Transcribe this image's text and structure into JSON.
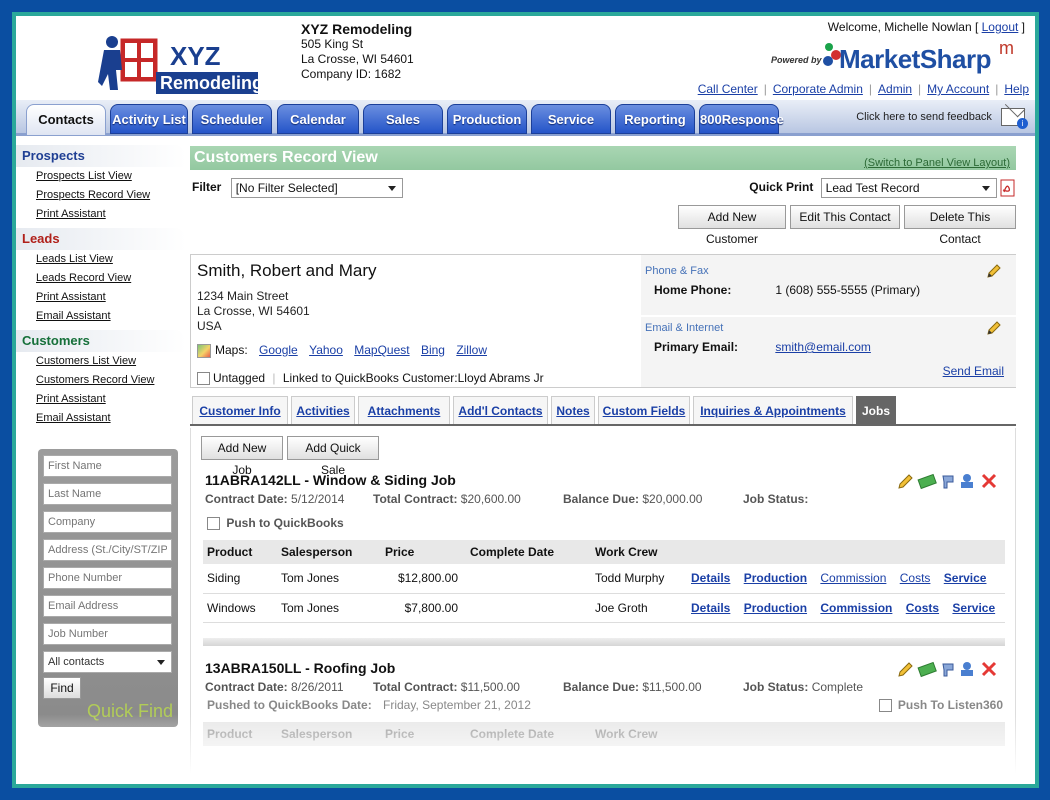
{
  "company": {
    "name": "XYZ Remodeling",
    "address1": "505 King St",
    "address2": "La Crosse, WI 54601",
    "company_id": "Company ID: 1682",
    "logo_line1": "XYZ",
    "logo_line2": "Remodeling"
  },
  "welcome": {
    "text": "Welcome, Michelle Nowlan [ ",
    "logout": "Logout",
    "close": " ]"
  },
  "powered": {
    "label": "Powered by",
    "brand": "MarketSharp",
    "sup": "m"
  },
  "top_links": [
    "Call Center",
    "Corporate Admin",
    "Admin",
    "My Account",
    "Help"
  ],
  "main_tabs": [
    "Contacts",
    "Activity List",
    "Scheduler",
    "Calendar",
    "Sales",
    "Production",
    "Service",
    "Reporting",
    "800Response"
  ],
  "feedback": "Click here to send feedback",
  "sidebar": {
    "prospects": {
      "title": "Prospects",
      "items": [
        "Prospects List View",
        "Prospects Record View",
        "Print Assistant"
      ]
    },
    "leads": {
      "title": "Leads",
      "items": [
        "Leads List View",
        "Leads Record View",
        "Print Assistant",
        "Email Assistant"
      ]
    },
    "customers": {
      "title": "Customers",
      "items": [
        "Customers List View",
        "Customers Record View",
        "Print Assistant",
        "Email Assistant"
      ]
    }
  },
  "quick_find": {
    "placeholders": [
      "First Name",
      "Last Name",
      "Company",
      "Address (St./City/ST/ZIP)",
      "Phone Number",
      "Email Address",
      "Job Number"
    ],
    "select": "All contacts",
    "button": "Find",
    "title": "Quick Find"
  },
  "record": {
    "title": "Customers Record View",
    "switch_link": "(Switch to Panel View Layout)",
    "filter_label": "Filter",
    "filter_value": "[No Filter Selected]",
    "quick_print_label": "Quick Print",
    "quick_print_value": "Lead Test Record",
    "buttons": [
      "Add New Customer",
      "Edit This Contact",
      "Delete This Contact"
    ]
  },
  "contact": {
    "name": "Smith, Robert and Mary",
    "street": "1234 Main Street",
    "city": "La Crosse, WI 54601",
    "country": "USA",
    "maps_label": "Maps:",
    "maps": [
      "Google",
      "Yahoo",
      "MapQuest",
      "Bing",
      "Zillow"
    ],
    "untagged": "Untagged",
    "quickbooks": "Linked to QuickBooks Customer:Lloyd Abrams Jr",
    "phone_header": "Phone & Fax",
    "home_phone_label": "Home Phone:",
    "home_phone": "1 (608) 555-5555 (Primary)",
    "email_header": "Email & Internet",
    "primary_email_label": "Primary Email:",
    "primary_email": "smith@email.com",
    "send_email": "Send Email"
  },
  "record_tabs": [
    "Customer Info",
    "Activities",
    "Attachments",
    "Add'l Contacts",
    "Notes",
    "Custom Fields",
    "Inquiries & Appointments",
    "Jobs"
  ],
  "jobs_buttons": [
    "Add New Job",
    "Add Quick Sale"
  ],
  "table_headers": [
    "Product",
    "Salesperson",
    "Price",
    "Complete Date",
    "Work Crew"
  ],
  "row_links": [
    "Details",
    "Production",
    "Commission",
    "Costs",
    "Service"
  ],
  "jobs": [
    {
      "title": "11ABRA142LL - Window & Siding Job",
      "contract_date_label": "Contract Date:",
      "contract_date": "5/12/2014",
      "total_label": "Total Contract:",
      "total": "$20,600.00",
      "balance_label": "Balance Due:",
      "balance": "$20,000.00",
      "status_label": "Job Status:",
      "status": "",
      "push_label": "Push to QuickBooks",
      "rows": [
        {
          "product": "Siding",
          "salesperson": "Tom Jones",
          "price": "$12,800.00",
          "complete": "",
          "crew": "Todd Murphy"
        },
        {
          "product": "Windows",
          "salesperson": "Tom Jones",
          "price": "$7,800.00",
          "complete": "",
          "crew": "Joe Groth"
        }
      ]
    },
    {
      "title": "13ABRA150LL - Roofing Job",
      "contract_date_label": "Contract Date:",
      "contract_date": "8/26/2011",
      "total_label": "Total Contract:",
      "total": "$11,500.00",
      "balance_label": "Balance Due:",
      "balance": "$11,500.00",
      "status_label": "Job Status:",
      "status": "Complete",
      "pushed_label": "Pushed to QuickBooks Date:",
      "pushed_date": "Friday, September 21, 2012",
      "listen_label": "Push To Listen360"
    }
  ]
}
